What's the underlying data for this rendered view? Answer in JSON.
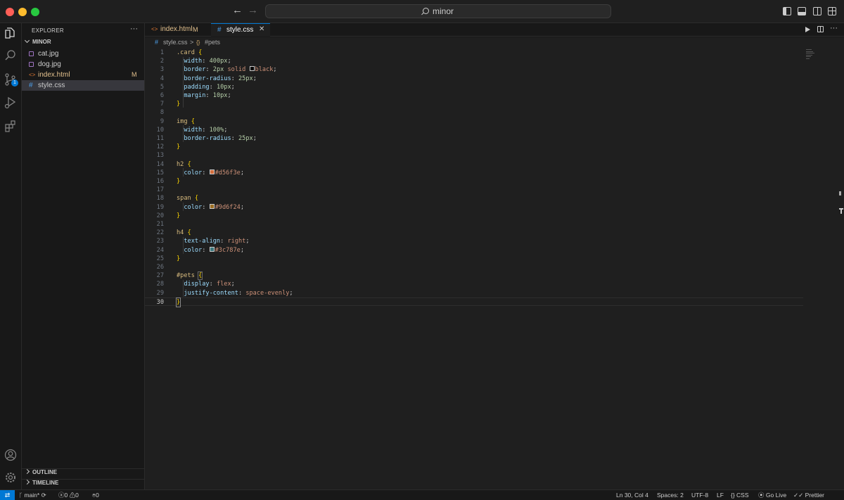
{
  "window": {
    "search_text": "minor",
    "icons": [
      "back-arrow-icon",
      "forward-arrow-icon",
      "search-icon",
      "toggle-primary-sidebar-icon",
      "toggle-panel-icon",
      "toggle-secondary-sidebar-icon",
      "customize-layout-icon"
    ]
  },
  "activity_bar": {
    "items": [
      "explorer-icon",
      "search-icon",
      "source-control-icon",
      "run-debug-icon",
      "extensions-icon"
    ],
    "source_control_badge": "1",
    "bottom_items": [
      "accounts-icon",
      "manage-gear-icon"
    ]
  },
  "explorer": {
    "title": "EXPLORER",
    "more": "···",
    "folder": "MINOR",
    "files": [
      {
        "name": "cat.jpg",
        "status": "",
        "icon": "image-file-icon"
      },
      {
        "name": "dog.jpg",
        "status": "",
        "icon": "image-file-icon"
      },
      {
        "name": "index.html",
        "status": "M",
        "icon": "html-file-icon"
      },
      {
        "name": "style.css",
        "status": "",
        "icon": "css-file-icon",
        "active": true
      }
    ],
    "outline_label": "OUTLINE",
    "timeline_label": "TIMELINE"
  },
  "tabs": [
    {
      "label": "index.html",
      "status": "M",
      "icon_glyph": "<>",
      "active": false
    },
    {
      "label": "style.css",
      "status": "",
      "icon_glyph": "#",
      "active": true,
      "close": "✕"
    }
  ],
  "breadcrumb": {
    "hash": "#",
    "file": "style.css",
    "separator": ">",
    "symbol_icon": "{}",
    "symbol": "#pets"
  },
  "editor": {
    "current_line": 30,
    "line_numbers": [
      "1",
      "2",
      "3",
      "4",
      "5",
      "6",
      "7",
      "8",
      "9",
      "10",
      "11",
      "12",
      "13",
      "14",
      "15",
      "16",
      "17",
      "18",
      "19",
      "20",
      "21",
      "22",
      "23",
      "24",
      "25",
      "26",
      "27",
      "28",
      "29",
      "30"
    ]
  },
  "status_bar": {
    "branch": "main*",
    "errors": "0",
    "warnings": "0",
    "ports": "0",
    "position": "Ln 30, Col 4",
    "spaces": "Spaces: 2",
    "encoding": "UTF-8",
    "eol": "LF",
    "language": "CSS",
    "go_live": "Go Live",
    "prettier": "Prettier",
    "colors": {
      "remote": "#0078d4"
    }
  },
  "colors": {
    "h2_color": "#d56f3e",
    "span_color": "#9d6f24",
    "h4_color": "#3c787e"
  }
}
